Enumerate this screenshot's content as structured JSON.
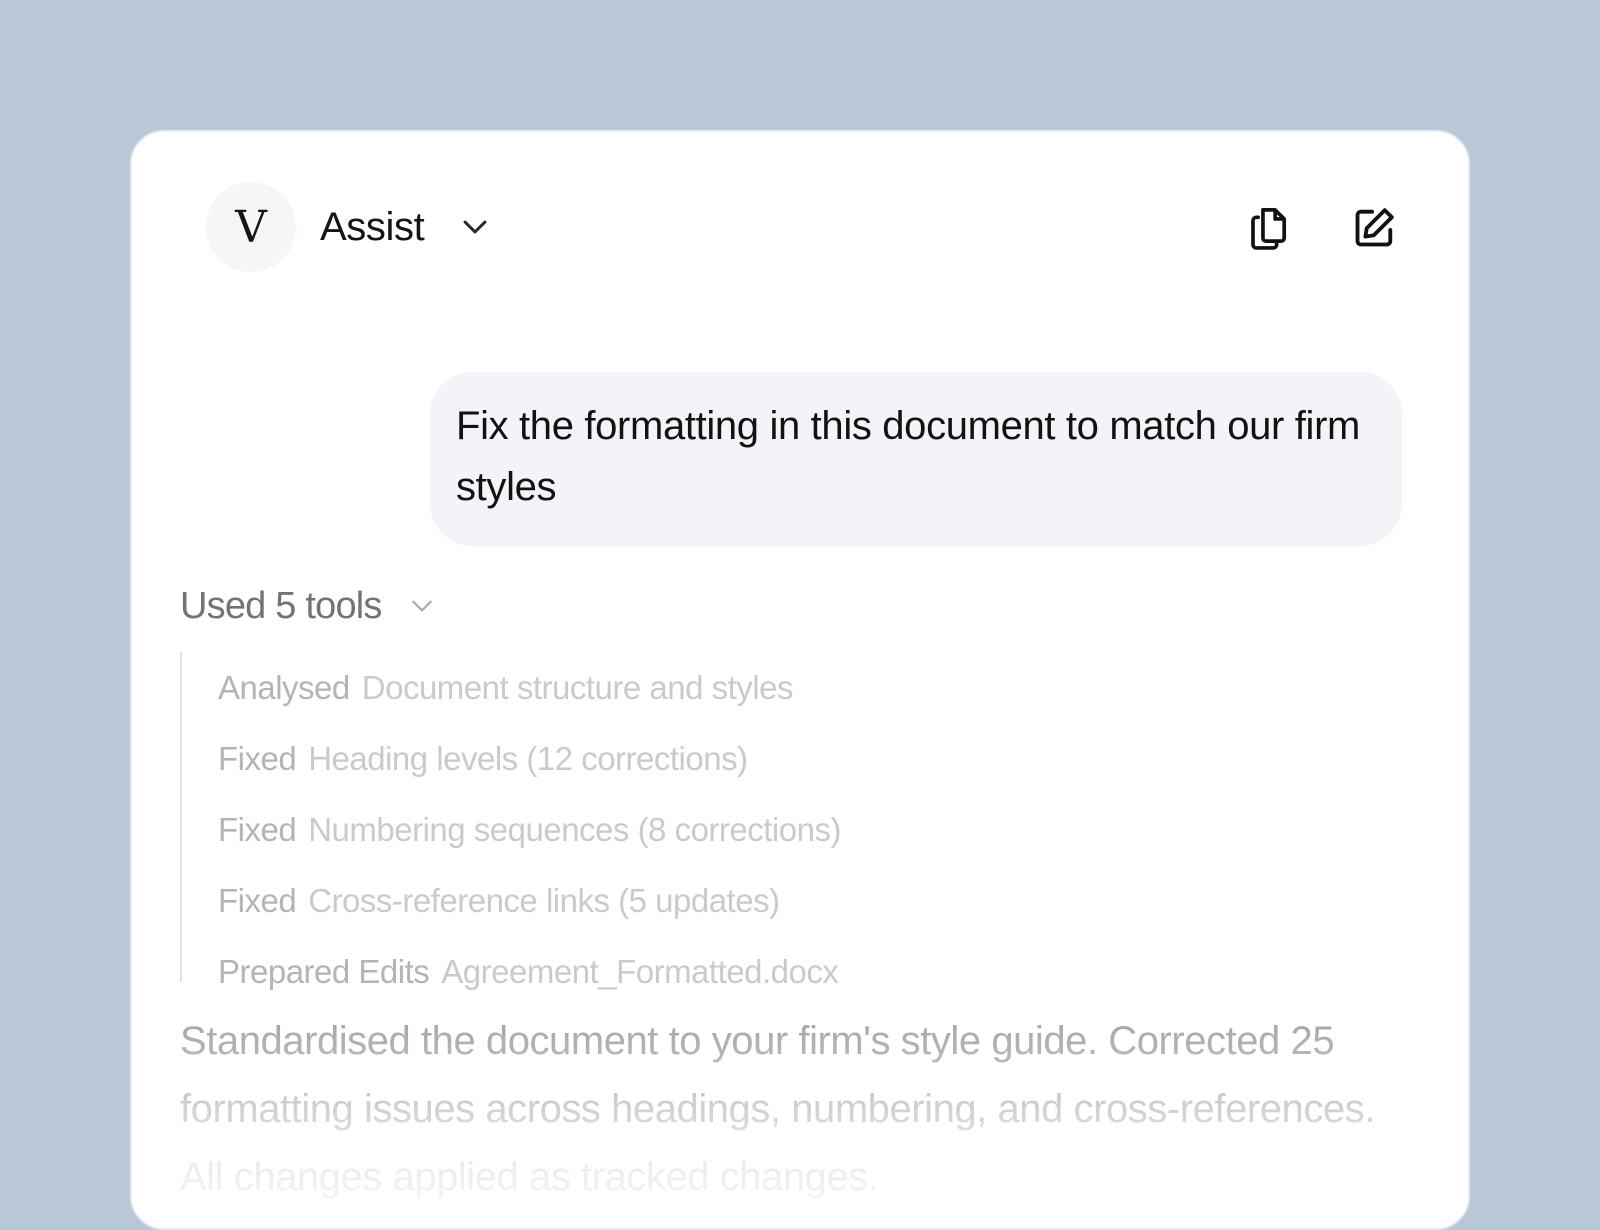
{
  "header": {
    "avatar_letter": "V",
    "mode_label": "Assist",
    "mode_options": [
      "Assist"
    ],
    "actions": {
      "copy_icon": "copy-document-icon",
      "new_chat_icon": "edit-square-icon"
    }
  },
  "conversation": {
    "user_message": "Fix the formatting in this document to match our firm styles",
    "tools": {
      "summary_label": "Used 5 tools",
      "items": [
        {
          "action": "Analysed",
          "detail": "Document structure and styles"
        },
        {
          "action": "Fixed",
          "detail": "Heading levels (12 corrections)"
        },
        {
          "action": "Fixed",
          "detail": "Numbering sequences (8 corrections)"
        },
        {
          "action": "Fixed",
          "detail": "Cross-reference links (5 updates)"
        },
        {
          "action": "Prepared Edits",
          "detail": "Agreement_Formatted.docx"
        }
      ]
    },
    "assistant_summary": "Standardised the document to your firm's style guide. Corrected 25 formatting issues across headings, numbering, and cross-references. All changes applied as tracked changes."
  },
  "colors": {
    "background": "#b8c8d8",
    "panel": "#ffffff",
    "user_bubble": "#f5f3f7",
    "primary_text": "#121212",
    "muted_text": "#a7a7a9"
  }
}
